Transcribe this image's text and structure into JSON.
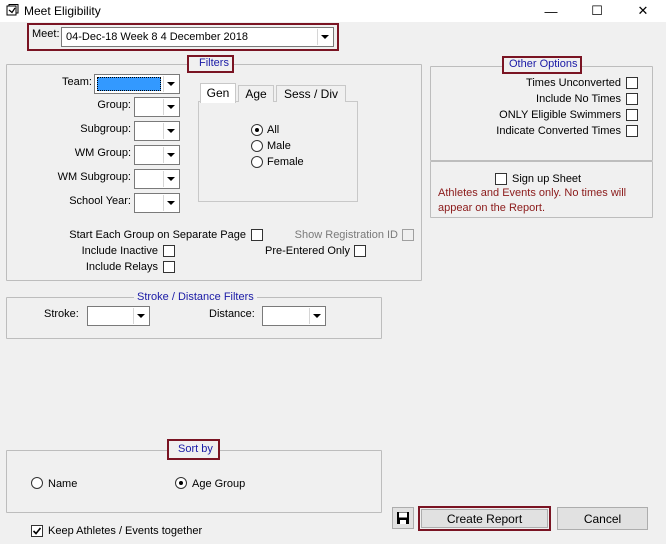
{
  "window": {
    "title": "Meet Eligibility",
    "minimize_glyph": "—",
    "maximize_glyph": "☐",
    "close_glyph": "✕"
  },
  "meet": {
    "label": "Meet:",
    "value": "04-Dec-18 Week 8 4 December 2018"
  },
  "filters": {
    "legend": "Filters",
    "fields": [
      {
        "label": "Team:"
      },
      {
        "label": "Group:"
      },
      {
        "label": "Subgroup:"
      },
      {
        "label": "WM Group:"
      },
      {
        "label": "WM Subgroup:"
      },
      {
        "label": "School Year:"
      }
    ],
    "tabs": [
      "Gen",
      "Age",
      "Sess / Div"
    ],
    "gender_options": [
      "All",
      "Male",
      "Female"
    ],
    "selected_gender": "All",
    "start_each_group": "Start Each Group on Separate Page",
    "include_inactive": "Include Inactive",
    "include_relays": "Include Relays",
    "show_registration_id": "Show Registration ID",
    "pre_entered_only": "Pre-Entered Only"
  },
  "other_options": {
    "legend": "Other Options",
    "items": [
      "Times Unconverted",
      "Include No Times",
      "ONLY Eligible Swimmers",
      "Indicate Converted Times"
    ],
    "signup_sheet": "Sign up Sheet",
    "signup_note": "Athletes and Events only.  No times will appear on the Report."
  },
  "stroke_filters": {
    "legend": "Stroke / Distance Filters",
    "stroke_label": "Stroke:",
    "distance_label": "Distance:"
  },
  "sort_by": {
    "legend": "Sort by",
    "options": [
      "Name",
      "Age Group"
    ],
    "selected": "Age Group"
  },
  "keep_together": {
    "label": "Keep Athletes / Events together",
    "checked": true
  },
  "buttons": {
    "create_report": "Create Report",
    "cancel": "Cancel"
  },
  "colors": {
    "highlight": "#7a1423",
    "legend_text": "#1a1aa6",
    "note_text": "#8b1a1a",
    "selection": "#3399ff"
  }
}
